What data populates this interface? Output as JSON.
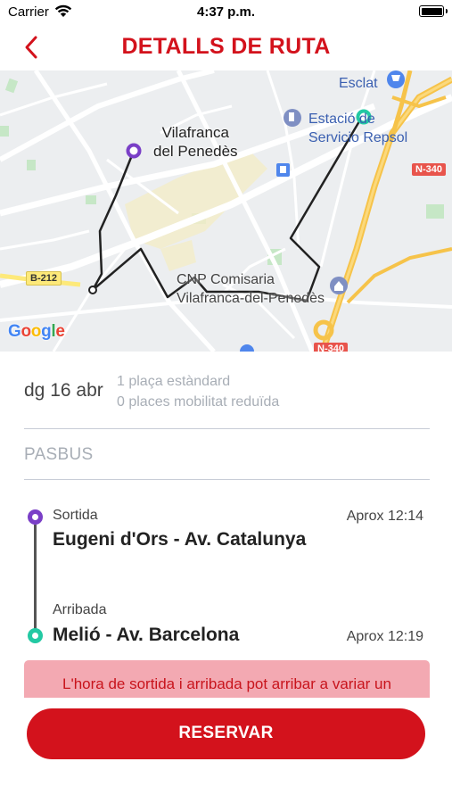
{
  "status_bar": {
    "carrier": "Carrier",
    "time": "4:37 p.m."
  },
  "header": {
    "title": "DETALLS DE RUTA"
  },
  "map": {
    "city_label_line1": "Vilafranca",
    "city_label_line2": "del Penedès",
    "poi_esclat": "Esclat",
    "poi_repsol_line1": "Estació de",
    "poi_repsol_line2": "Servicio Repsol",
    "poi_cnp_line1": "CNP Comisaria",
    "poi_cnp_line2": "Vilafranca-del-Penedès",
    "road_b212": "B-212",
    "road_n340": "N-340",
    "road_n340_bottom": "N-340",
    "attribution": "Google",
    "route_color": "#222222",
    "origin_color": "#7a3fc7",
    "destination_color": "#23c9a3"
  },
  "trip": {
    "date": "dg 16 abr",
    "seats_standard": "1 plaça estàndard",
    "seats_reduced_mobility": "0 places mobilitat reduïda",
    "operator": "PASBUS"
  },
  "departure": {
    "kind": "Sortida",
    "name": "Eugeni d'Ors - Av. Catalunya",
    "time": "Aprox 12:14"
  },
  "arrival": {
    "kind": "Arribada",
    "name": "Melió - Av. Barcelona",
    "time": "Aprox 12:19"
  },
  "alert": {
    "text": "L'hora de sortida i arribada pot arribar a variar un"
  },
  "actions": {
    "reserve_label": "RESERVAR"
  },
  "colors": {
    "brand_red": "#d3121c",
    "alert_bg": "#f3a9b2",
    "muted_text": "#a8aeb6"
  }
}
